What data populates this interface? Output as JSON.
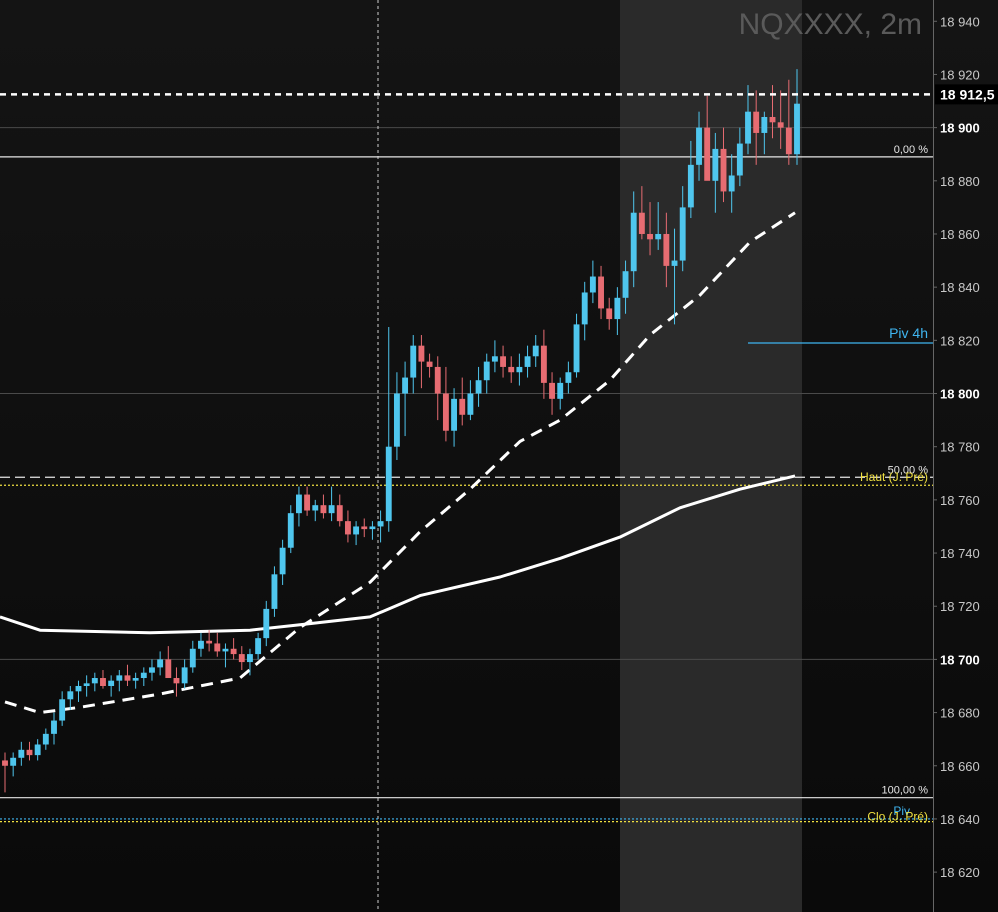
{
  "chart_data": {
    "type": "candlestick",
    "title": "NQXXXX, 2m",
    "y_axis": {
      "range": [
        18605,
        18948
      ],
      "tick_values": [
        18620,
        18640,
        18660,
        18680,
        18700,
        18720,
        18740,
        18760,
        18780,
        18800,
        18820,
        18840,
        18860,
        18880,
        18900,
        18920,
        18940
      ],
      "tick_labels": [
        "18 620",
        "18 640",
        "18 660",
        "18 680",
        "18 700",
        "18 720",
        "18 740",
        "18 760",
        "18 780",
        "18 800",
        "18 820",
        "18 840",
        "18 860",
        "18 880",
        "18 900",
        "18 920",
        "18 940"
      ],
      "bold_ticks": [
        18700,
        18800,
        18900
      ],
      "side": "right"
    },
    "current_price": {
      "value": 18912.5,
      "label": "18 912,5"
    },
    "levels": [
      {
        "name": "0,00 %",
        "value": 18889,
        "color": "#e6e6e6",
        "style": "solid"
      },
      {
        "name": "Piv 4h",
        "value": 18819,
        "color": "#3fb5f0",
        "style": "solid"
      },
      {
        "name": "50,00 %",
        "value": 18768.5,
        "color": "#e6e6e6",
        "style": "dashed"
      },
      {
        "name": "Haut (J. Pré)",
        "value": 18765.5,
        "color": "#f0e040",
        "style": "dotted"
      },
      {
        "name": "100,00 %",
        "value": 18648,
        "color": "#e6e6e6",
        "style": "solid"
      },
      {
        "name": "Piv",
        "value": 18640,
        "color": "#3fb5f0",
        "style": "dotted"
      },
      {
        "name": "Clo (J. Pré)",
        "value": 18639,
        "color": "#f0e040",
        "style": "dotted"
      }
    ],
    "bullish_color": "#4fc6ee",
    "bearish_color": "#e76c72",
    "candles": [
      [
        18662,
        18665,
        18650,
        18660
      ],
      [
        18660,
        18665,
        18656,
        18663
      ],
      [
        18663,
        18669,
        18660,
        18666
      ],
      [
        18666,
        18669,
        18662,
        18664
      ],
      [
        18664,
        18670,
        18662,
        18668
      ],
      [
        18668,
        18674,
        18666,
        18672
      ],
      [
        18672,
        18680,
        18668,
        18677
      ],
      [
        18677,
        18688,
        18675,
        18685
      ],
      [
        18685,
        18690,
        18681,
        18688
      ],
      [
        18688,
        18692,
        18684,
        18690
      ],
      [
        18690,
        18694,
        18686,
        18691
      ],
      [
        18691,
        18695,
        18688,
        18693
      ],
      [
        18693,
        18696,
        18689,
        18690
      ],
      [
        18690,
        18694,
        18686,
        18692
      ],
      [
        18692,
        18696,
        18688,
        18694
      ],
      [
        18694,
        18698,
        18690,
        18692
      ],
      [
        18692,
        18695,
        18689,
        18693
      ],
      [
        18693,
        18697,
        18690,
        18695
      ],
      [
        18695,
        18700,
        18692,
        18697
      ],
      [
        18697,
        18703,
        18694,
        18700
      ],
      [
        18700,
        18705,
        18695,
        18693
      ],
      [
        18693,
        18697,
        18686,
        18691
      ],
      [
        18691,
        18700,
        18689,
        18697
      ],
      [
        18697,
        18707,
        18695,
        18704
      ],
      [
        18704,
        18710,
        18701,
        18707
      ],
      [
        18707,
        18711,
        18703,
        18706
      ],
      [
        18706,
        18710,
        18701,
        18703
      ],
      [
        18703,
        18706,
        18697,
        18704
      ],
      [
        18704,
        18708,
        18700,
        18702
      ],
      [
        18702,
        18705,
        18696,
        18699
      ],
      [
        18699,
        18704,
        18694,
        18702
      ],
      [
        18702,
        18710,
        18700,
        18708
      ],
      [
        18708,
        18722,
        18705,
        18719
      ],
      [
        18719,
        18735,
        18716,
        18732
      ],
      [
        18732,
        18745,
        18728,
        18742
      ],
      [
        18742,
        18758,
        18740,
        18755
      ],
      [
        18755,
        18765,
        18750,
        18762
      ],
      [
        18762,
        18765,
        18754,
        18756
      ],
      [
        18756,
        18760,
        18752,
        18758
      ],
      [
        18758,
        18762,
        18753,
        18755
      ],
      [
        18755,
        18765,
        18752,
        18758
      ],
      [
        18758,
        18762,
        18750,
        18752
      ],
      [
        18752,
        18756,
        18744,
        18747
      ],
      [
        18747,
        18752,
        18743,
        18750
      ],
      [
        18750,
        18753,
        18746,
        18749
      ],
      [
        18749,
        18752,
        18745,
        18750
      ],
      [
        18750,
        18756,
        18744,
        18752
      ],
      [
        18752,
        18825,
        18748,
        18780
      ],
      [
        18780,
        18808,
        18775,
        18800
      ],
      [
        18800,
        18812,
        18784,
        18806
      ],
      [
        18806,
        18822,
        18800,
        18818
      ],
      [
        18818,
        18822,
        18802,
        18812
      ],
      [
        18812,
        18815,
        18806,
        18810
      ],
      [
        18810,
        18814,
        18790,
        18800
      ],
      [
        18800,
        18810,
        18782,
        18786
      ],
      [
        18786,
        18802,
        18780,
        18798
      ],
      [
        18798,
        18806,
        18788,
        18792
      ],
      [
        18792,
        18805,
        18790,
        18800
      ],
      [
        18800,
        18810,
        18795,
        18805
      ],
      [
        18805,
        18815,
        18800,
        18812
      ],
      [
        18812,
        18820,
        18808,
        18814
      ],
      [
        18814,
        18818,
        18806,
        18810
      ],
      [
        18810,
        18814,
        18804,
        18808
      ],
      [
        18808,
        18815,
        18803,
        18810
      ],
      [
        18810,
        18818,
        18806,
        18814
      ],
      [
        18814,
        18822,
        18810,
        18818
      ],
      [
        18818,
        18824,
        18798,
        18804
      ],
      [
        18804,
        18808,
        18792,
        18798
      ],
      [
        18798,
        18806,
        18794,
        18804
      ],
      [
        18804,
        18812,
        18800,
        18808
      ],
      [
        18808,
        18830,
        18806,
        18826
      ],
      [
        18826,
        18842,
        18820,
        18838
      ],
      [
        18838,
        18850,
        18834,
        18844
      ],
      [
        18844,
        18848,
        18828,
        18832
      ],
      [
        18832,
        18836,
        18824,
        18828
      ],
      [
        18828,
        18840,
        18822,
        18836
      ],
      [
        18836,
        18850,
        18830,
        18846
      ],
      [
        18846,
        18876,
        18840,
        18868
      ],
      [
        18868,
        18878,
        18858,
        18860
      ],
      [
        18860,
        18872,
        18852,
        18858
      ],
      [
        18858,
        18872,
        18854,
        18860
      ],
      [
        18860,
        18868,
        18840,
        18848
      ],
      [
        18848,
        18862,
        18826,
        18850
      ],
      [
        18850,
        18878,
        18846,
        18870
      ],
      [
        18870,
        18895,
        18866,
        18886
      ],
      [
        18886,
        18906,
        18880,
        18900
      ],
      [
        18900,
        18912,
        18884,
        18880
      ],
      [
        18880,
        18898,
        18868,
        18892
      ],
      [
        18892,
        18900,
        18872,
        18876
      ],
      [
        18876,
        18890,
        18868,
        18882
      ],
      [
        18882,
        18900,
        18878,
        18894
      ],
      [
        18894,
        18916,
        18890,
        18906
      ],
      [
        18906,
        18914,
        18886,
        18898
      ],
      [
        18898,
        18906,
        18890,
        18904
      ],
      [
        18904,
        18916,
        18896,
        18902
      ],
      [
        18902,
        18914,
        18892,
        18900
      ],
      [
        18900,
        18918,
        18886,
        18890
      ],
      [
        18890,
        18922,
        18886,
        18909
      ]
    ],
    "moving_averages": [
      {
        "name": "long",
        "style": "solid",
        "color": "#ffffff",
        "values": [
          [
            0,
            18716
          ],
          [
            40,
            18711
          ],
          [
            150,
            18710
          ],
          [
            250,
            18711
          ],
          [
            300,
            18713
          ],
          [
            370,
            18716
          ],
          [
            420,
            18724
          ],
          [
            500,
            18731
          ],
          [
            560,
            18738
          ],
          [
            620,
            18746
          ],
          [
            680,
            18757
          ],
          [
            740,
            18764
          ],
          [
            795,
            18769
          ]
        ]
      },
      {
        "name": "short",
        "style": "dashed",
        "color": "#ffffff",
        "values": [
          [
            5,
            18684
          ],
          [
            40,
            18680
          ],
          [
            80,
            18682
          ],
          [
            160,
            18687
          ],
          [
            240,
            18693
          ],
          [
            300,
            18712
          ],
          [
            370,
            18729
          ],
          [
            420,
            18748
          ],
          [
            470,
            18764
          ],
          [
            520,
            18782
          ],
          [
            560,
            18790
          ],
          [
            610,
            18805
          ],
          [
            650,
            18822
          ],
          [
            700,
            18837
          ],
          [
            750,
            18857
          ],
          [
            795,
            18868
          ]
        ]
      }
    ]
  }
}
